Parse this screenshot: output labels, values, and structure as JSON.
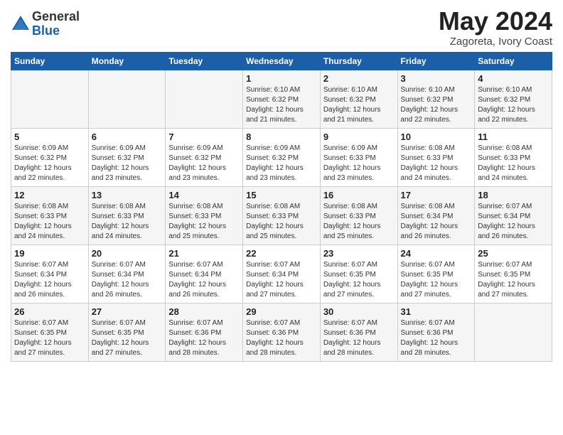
{
  "header": {
    "logo_general": "General",
    "logo_blue": "Blue",
    "month": "May 2024",
    "location": "Zagoreta, Ivory Coast"
  },
  "days_of_week": [
    "Sunday",
    "Monday",
    "Tuesday",
    "Wednesday",
    "Thursday",
    "Friday",
    "Saturday"
  ],
  "weeks": [
    [
      {
        "day": "",
        "info": ""
      },
      {
        "day": "",
        "info": ""
      },
      {
        "day": "",
        "info": ""
      },
      {
        "day": "1",
        "info": "Sunrise: 6:10 AM\nSunset: 6:32 PM\nDaylight: 12 hours\nand 21 minutes."
      },
      {
        "day": "2",
        "info": "Sunrise: 6:10 AM\nSunset: 6:32 PM\nDaylight: 12 hours\nand 21 minutes."
      },
      {
        "day": "3",
        "info": "Sunrise: 6:10 AM\nSunset: 6:32 PM\nDaylight: 12 hours\nand 22 minutes."
      },
      {
        "day": "4",
        "info": "Sunrise: 6:10 AM\nSunset: 6:32 PM\nDaylight: 12 hours\nand 22 minutes."
      }
    ],
    [
      {
        "day": "5",
        "info": "Sunrise: 6:09 AM\nSunset: 6:32 PM\nDaylight: 12 hours\nand 22 minutes."
      },
      {
        "day": "6",
        "info": "Sunrise: 6:09 AM\nSunset: 6:32 PM\nDaylight: 12 hours\nand 23 minutes."
      },
      {
        "day": "7",
        "info": "Sunrise: 6:09 AM\nSunset: 6:32 PM\nDaylight: 12 hours\nand 23 minutes."
      },
      {
        "day": "8",
        "info": "Sunrise: 6:09 AM\nSunset: 6:32 PM\nDaylight: 12 hours\nand 23 minutes."
      },
      {
        "day": "9",
        "info": "Sunrise: 6:09 AM\nSunset: 6:33 PM\nDaylight: 12 hours\nand 23 minutes."
      },
      {
        "day": "10",
        "info": "Sunrise: 6:08 AM\nSunset: 6:33 PM\nDaylight: 12 hours\nand 24 minutes."
      },
      {
        "day": "11",
        "info": "Sunrise: 6:08 AM\nSunset: 6:33 PM\nDaylight: 12 hours\nand 24 minutes."
      }
    ],
    [
      {
        "day": "12",
        "info": "Sunrise: 6:08 AM\nSunset: 6:33 PM\nDaylight: 12 hours\nand 24 minutes."
      },
      {
        "day": "13",
        "info": "Sunrise: 6:08 AM\nSunset: 6:33 PM\nDaylight: 12 hours\nand 24 minutes."
      },
      {
        "day": "14",
        "info": "Sunrise: 6:08 AM\nSunset: 6:33 PM\nDaylight: 12 hours\nand 25 minutes."
      },
      {
        "day": "15",
        "info": "Sunrise: 6:08 AM\nSunset: 6:33 PM\nDaylight: 12 hours\nand 25 minutes."
      },
      {
        "day": "16",
        "info": "Sunrise: 6:08 AM\nSunset: 6:33 PM\nDaylight: 12 hours\nand 25 minutes."
      },
      {
        "day": "17",
        "info": "Sunrise: 6:08 AM\nSunset: 6:34 PM\nDaylight: 12 hours\nand 26 minutes."
      },
      {
        "day": "18",
        "info": "Sunrise: 6:07 AM\nSunset: 6:34 PM\nDaylight: 12 hours\nand 26 minutes."
      }
    ],
    [
      {
        "day": "19",
        "info": "Sunrise: 6:07 AM\nSunset: 6:34 PM\nDaylight: 12 hours\nand 26 minutes."
      },
      {
        "day": "20",
        "info": "Sunrise: 6:07 AM\nSunset: 6:34 PM\nDaylight: 12 hours\nand 26 minutes."
      },
      {
        "day": "21",
        "info": "Sunrise: 6:07 AM\nSunset: 6:34 PM\nDaylight: 12 hours\nand 26 minutes."
      },
      {
        "day": "22",
        "info": "Sunrise: 6:07 AM\nSunset: 6:34 PM\nDaylight: 12 hours\nand 27 minutes."
      },
      {
        "day": "23",
        "info": "Sunrise: 6:07 AM\nSunset: 6:35 PM\nDaylight: 12 hours\nand 27 minutes."
      },
      {
        "day": "24",
        "info": "Sunrise: 6:07 AM\nSunset: 6:35 PM\nDaylight: 12 hours\nand 27 minutes."
      },
      {
        "day": "25",
        "info": "Sunrise: 6:07 AM\nSunset: 6:35 PM\nDaylight: 12 hours\nand 27 minutes."
      }
    ],
    [
      {
        "day": "26",
        "info": "Sunrise: 6:07 AM\nSunset: 6:35 PM\nDaylight: 12 hours\nand 27 minutes."
      },
      {
        "day": "27",
        "info": "Sunrise: 6:07 AM\nSunset: 6:35 PM\nDaylight: 12 hours\nand 27 minutes."
      },
      {
        "day": "28",
        "info": "Sunrise: 6:07 AM\nSunset: 6:36 PM\nDaylight: 12 hours\nand 28 minutes."
      },
      {
        "day": "29",
        "info": "Sunrise: 6:07 AM\nSunset: 6:36 PM\nDaylight: 12 hours\nand 28 minutes."
      },
      {
        "day": "30",
        "info": "Sunrise: 6:07 AM\nSunset: 6:36 PM\nDaylight: 12 hours\nand 28 minutes."
      },
      {
        "day": "31",
        "info": "Sunrise: 6:07 AM\nSunset: 6:36 PM\nDaylight: 12 hours\nand 28 minutes."
      },
      {
        "day": "",
        "info": ""
      }
    ]
  ]
}
